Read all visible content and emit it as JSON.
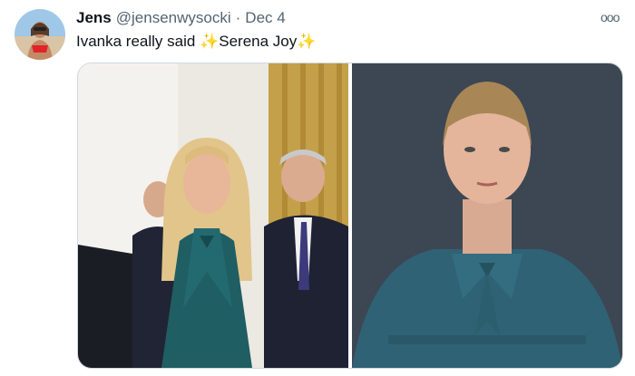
{
  "tweet": {
    "author_name": "Jens",
    "handle": "@jensenwysocki",
    "separator": "·",
    "date": "Dec 4",
    "text_before": "Ivanka really said",
    "sparkle": "✨",
    "text_middle": "Serena Joy",
    "more_label": "ooo"
  },
  "icons": {
    "more": "more-options-icon",
    "sparkle": "sparkles-icon"
  },
  "colors": {
    "text": "#0f1419",
    "secondary": "#536471",
    "border": "#cfd9de",
    "sparkle": "#f5b800"
  }
}
